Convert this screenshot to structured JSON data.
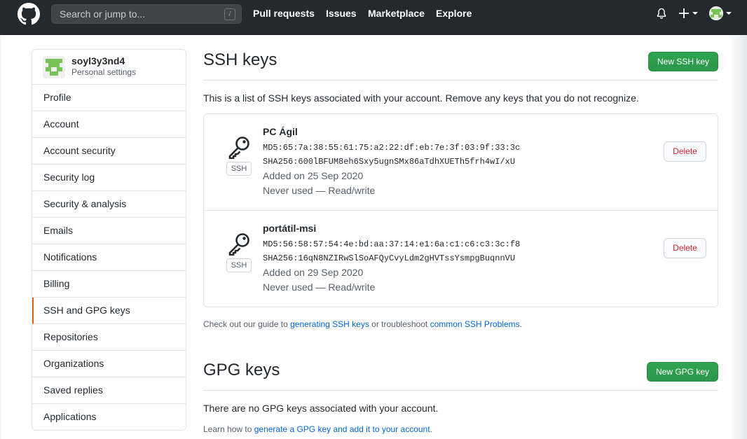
{
  "header": {
    "search_placeholder": "Search or jump to...",
    "search_key": "/",
    "nav": [
      "Pull requests",
      "Issues",
      "Marketplace",
      "Explore"
    ]
  },
  "sidebar": {
    "username": "soyl3y3nd4",
    "subtitle": "Personal settings",
    "items": [
      {
        "label": "Profile"
      },
      {
        "label": "Account"
      },
      {
        "label": "Account security"
      },
      {
        "label": "Security log"
      },
      {
        "label": "Security & analysis"
      },
      {
        "label": "Emails"
      },
      {
        "label": "Notifications"
      },
      {
        "label": "Billing"
      },
      {
        "label": "SSH and GPG keys",
        "selected": true
      },
      {
        "label": "Repositories"
      },
      {
        "label": "Organizations"
      },
      {
        "label": "Saved replies"
      },
      {
        "label": "Applications"
      }
    ]
  },
  "ssh": {
    "title": "SSH keys",
    "new_button": "New SSH key",
    "intro": "This is a list of SSH keys associated with your account. Remove any keys that you do not recognize.",
    "badge": "SSH",
    "delete_label": "Delete",
    "keys": [
      {
        "name": "PC Ágil",
        "md5": "MD5:65:7a:38:55:61:75:a2:22:df:eb:7e:3f:03:9f:33:3c",
        "sha256": "SHA256:600lBFUM8eh6Sxy5ugnSMx86aTdhXUETh5frh4wI/xU",
        "added": "Added on 25 Sep 2020",
        "usage": "Never used — Read/write"
      },
      {
        "name": "portátil-msi",
        "md5": "MD5:56:58:57:54:4e:bd:aa:37:14:e1:6a:c1:c6:c3:3c:f8",
        "sha256": "SHA256:16qN8NZIRwSlSoAFQyCvyLdm2gHVTssYsmpgBuqnnVU",
        "added": "Added on 29 Sep 2020",
        "usage": "Never used — Read/write"
      }
    ],
    "guide_prefix": "Check out our guide to",
    "guide_link1": "generating SSH keys",
    "guide_middle": "or troubleshoot",
    "guide_link2": "common SSH Problems",
    "guide_suffix": "."
  },
  "gpg": {
    "title": "GPG keys",
    "new_button": "New GPG key",
    "empty": "There are no GPG keys associated with your account.",
    "learn_prefix": "Learn how to",
    "learn_link": "generate a GPG key and add it to your account",
    "learn_suffix": "."
  },
  "colors": {
    "header_bg": "#24292e",
    "green": "#2ea44f",
    "link": "#0366d6",
    "danger": "#cb2431",
    "selected_accent": "#e36209"
  }
}
